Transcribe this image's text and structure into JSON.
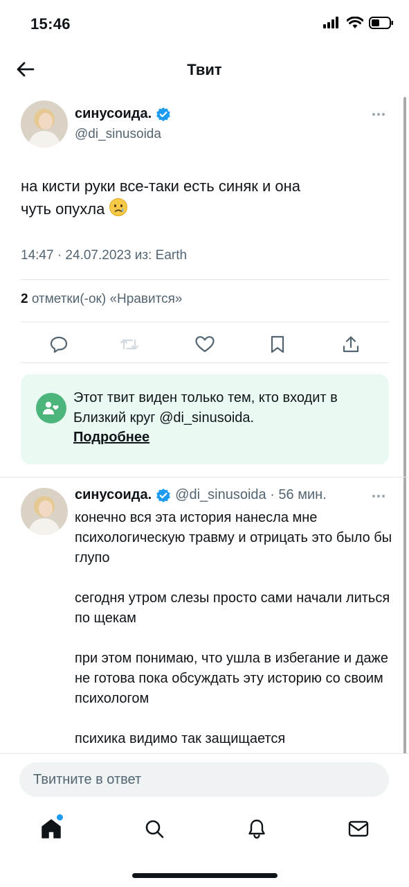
{
  "status_bar": {
    "time": "15:46"
  },
  "header": {
    "title": "Твит"
  },
  "main_tweet": {
    "display_name": "синусоида.",
    "handle": "@di_sinusoida",
    "text_line1": "на кисти руки все-таки есть синяк и она",
    "text_line2": "чуть опухла",
    "emoji": "crying-face",
    "meta": "14:47 · 24.07.2023 из: Earth",
    "likes_count": "2",
    "likes_label": " отметки(-ок) «Нравится»"
  },
  "circle_notice": {
    "text": "Этот твит виден только тем, кто входит в Близкий круг @di_sinusoida.",
    "link": "Подробнее"
  },
  "reply_tweet": {
    "display_name": "синусоида.",
    "handle_time": "@di_sinusoida · 56 мин.",
    "paragraphs": [
      "конечно вся эта история нанесла мне психологическую травму и отрицать это было бы глупо",
      "сегодня утром слезы просто сами начали литься по щекам",
      "при этом понимаю, что ушла в избегание и даже не готова пока обсуждать эту историю со своим психологом",
      "психика видимо так защищается"
    ]
  },
  "reply_input": {
    "placeholder": "Твитните в ответ"
  },
  "tabbar": {
    "items": [
      "home-icon",
      "search-icon",
      "notifications-icon",
      "messages-icon"
    ]
  },
  "colors": {
    "accent": "#1d9bf0",
    "circle_green": "#4bb57c",
    "notice_bg": "#eafaf3",
    "muted": "#536471"
  }
}
